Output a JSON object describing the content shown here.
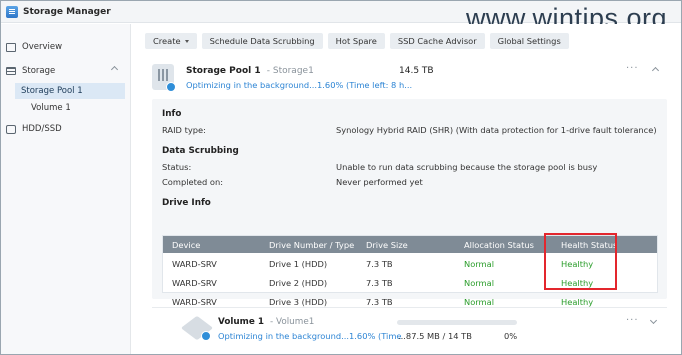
{
  "window": {
    "title": "Storage Manager"
  },
  "watermark": "www.wintips.org",
  "sidebar": {
    "items": [
      {
        "label": "Overview",
        "icon": "overview-icon"
      },
      {
        "label": "Storage",
        "icon": "storage-icon"
      },
      {
        "label": "Storage Pool 1"
      },
      {
        "label": "Volume 1"
      },
      {
        "label": "HDD/SSD",
        "icon": "hdd-icon"
      }
    ]
  },
  "toolbar": {
    "create": "Create",
    "schedule": "Schedule Data Scrubbing",
    "hot_spare": "Hot Spare",
    "ssd_cache": "SSD Cache Advisor",
    "global": "Global Settings"
  },
  "pool": {
    "name": "Storage Pool 1",
    "sub": "- Storage1",
    "size": "14.5 TB",
    "progress": "Optimizing in the background...1.60% (Time left: 8 h...",
    "menu": "···"
  },
  "info": {
    "title": "Info",
    "raid_label": "RAID type:",
    "raid_value": "Synology Hybrid RAID (SHR) (With data protection for 1-drive fault tolerance)"
  },
  "scrubbing": {
    "title": "Data Scrubbing",
    "status_label": "Status:",
    "status_value": "Unable to run data scrubbing because the storage pool is busy",
    "completed_label": "Completed on:",
    "completed_value": "Never performed yet"
  },
  "drive_info": {
    "title": "Drive Info",
    "headers": [
      "Device",
      "Drive Number / Type",
      "Drive Size",
      "Allocation Status",
      "Health Status"
    ],
    "rows": [
      {
        "device": "WARD-SRV",
        "drive": "Drive 1 (HDD)",
        "size": "7.3 TB",
        "allocation": "Normal",
        "health": "Healthy"
      },
      {
        "device": "WARD-SRV",
        "drive": "Drive 2 (HDD)",
        "size": "7.3 TB",
        "allocation": "Normal",
        "health": "Healthy"
      },
      {
        "device": "WARD-SRV",
        "drive": "Drive 3 (HDD)",
        "size": "7.3 TB",
        "allocation": "Normal",
        "health": "Healthy"
      }
    ]
  },
  "volume": {
    "name": "Volume 1",
    "sub": "- Volume1",
    "progress": "Optimizing in the background...1.60% (Time",
    "size": "...87.5 MB / 14 TB",
    "percent": "0%",
    "usage_fraction": 0.0,
    "menu": "···"
  },
  "colors": {
    "accent": "#2c84d4",
    "healthy": "#2a9d2a",
    "highlight_box": "#e3262d"
  }
}
